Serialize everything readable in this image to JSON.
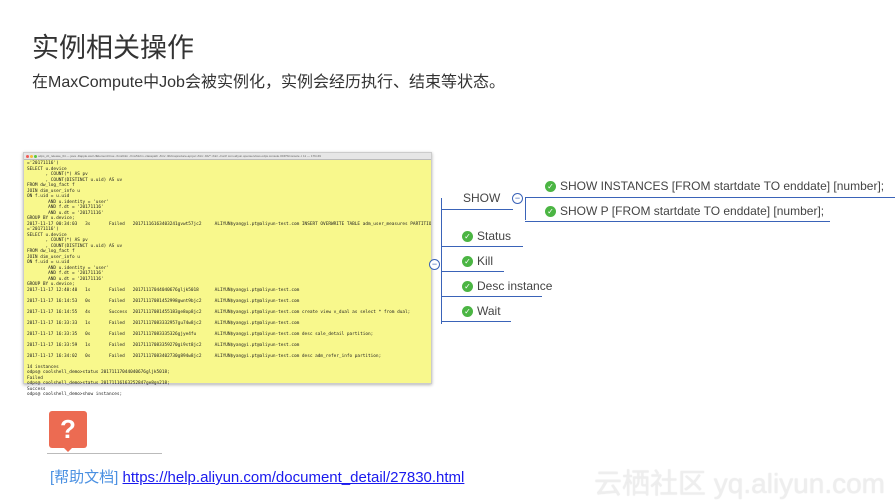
{
  "title": "实例相关操作",
  "subtitle": "在MaxCompute中Job会被实例化，实例会经历执行、结束等状态。",
  "terminal": {
    "title": "odps_clt_release_64 — java -Dapple.awt.UIElement=true -Xms64m -Xmx512m -classpath ./bin/../lib/mapreduce-api.jar:./bin/../lib/*:./bin/../conf/ com.aliyun.openservices.odps.console.ODPSConsole -I 11 — 176×49",
    "lines": [
      "='20171116')",
      "SELECT u.device",
      "       , COUNT(*) AS pv",
      "       , COUNT(DISTINCT u.uid) AS uv",
      "FROM dw_log_fact f",
      "JOIN dim_user_info u",
      "ON f.uid = u.uid",
      "        AND u.identity = 'user'",
      "        AND f.dt = '20171116'",
      "        AND u.dt = '20171116'",
      "GROUP BY u.device;",
      "2017-11-17 00:34:03   3s       Failed   20171116163403241gvwt57jc2     ALIYUN$yangyi.pt@aliyun-test.com INSERT OVERWRITE TABLE adm_user_measures PARTITION (dt",
      "='20171116')",
      "SELECT u.device",
      "       , COUNT(*) AS pv",
      "       , COUNT(DISTINCT u.uid) AS uv",
      "FROM dw_log_fact f",
      "JOIN dim_user_info u",
      "ON f.uid = u.uid",
      "        AND u.identity = 'user'",
      "        AND f.dt = '20171116'",
      "        AND u.dt = '20171116'",
      "GROUP BY u.device;",
      "2017-11-17 12:40:40   1s       Failed   20171117044040676gljk5018      ALIYUN$yangyi.pt@aliyun-test.com",
      "",
      "2017-11-17 16:14:53   0s       Failed   20171117081452998gwnt9bjc2     ALIYUN$yangyi.pt@aliyun-test.com",
      "",
      "2017-11-17 16:14:55   4s       Success  20171117081455183ge8op8jc2     ALIYUN$yangyi.pt@aliyun-test.com create view v_dual as select * from dual;",
      "",
      "2017-11-17 16:33:33   1s       Failed   20171117083332957gu74w8jc2     ALIYUN$yangyi.pt@aliyun-test.com",
      "",
      "2017-11-17 16:33:35   0s       Failed   20171117083335326gjye4fu       ALIYUN$yangyi.pt@aliyun-test.com desc sale_detail partition;",
      "",
      "2017-11-17 16:33:59   1s       Failed   20171117083359270gi9st8jc2     ALIYUN$yangyi.pt@aliyun-test.com",
      "",
      "2017-11-17 16:34:02   0s       Failed   20171117083402730g894w8jc2     ALIYUN$yangyi.pt@aliyun-test.com desc adm_refer_info partition;",
      "",
      "14 instances",
      "odps@ coolshell_demo>status 20171117044040676gljk5018;",
      "Failed",
      "odps@ coolshell_demo>status 20171116163252847ge8gn218;",
      "Success",
      "odps@ coolshell_demo>show instances;"
    ]
  },
  "mindmap": {
    "show": "SHOW",
    "show_children": [
      "SHOW INSTANCES [FROM startdate TO enddate] [number];",
      "SHOW P [FROM startdate TO enddate] [number];"
    ],
    "items": [
      "Status",
      "Kill",
      "Desc instance",
      "Wait"
    ],
    "line_color": "#3a63b8",
    "check_color": "#4bb543"
  },
  "help": {
    "icon": "?",
    "label": "[帮助文档]",
    "link": "https://help.aliyun.com/document_detail/27830.html"
  },
  "watermark": "云栖社区 yq.aliyun.com"
}
